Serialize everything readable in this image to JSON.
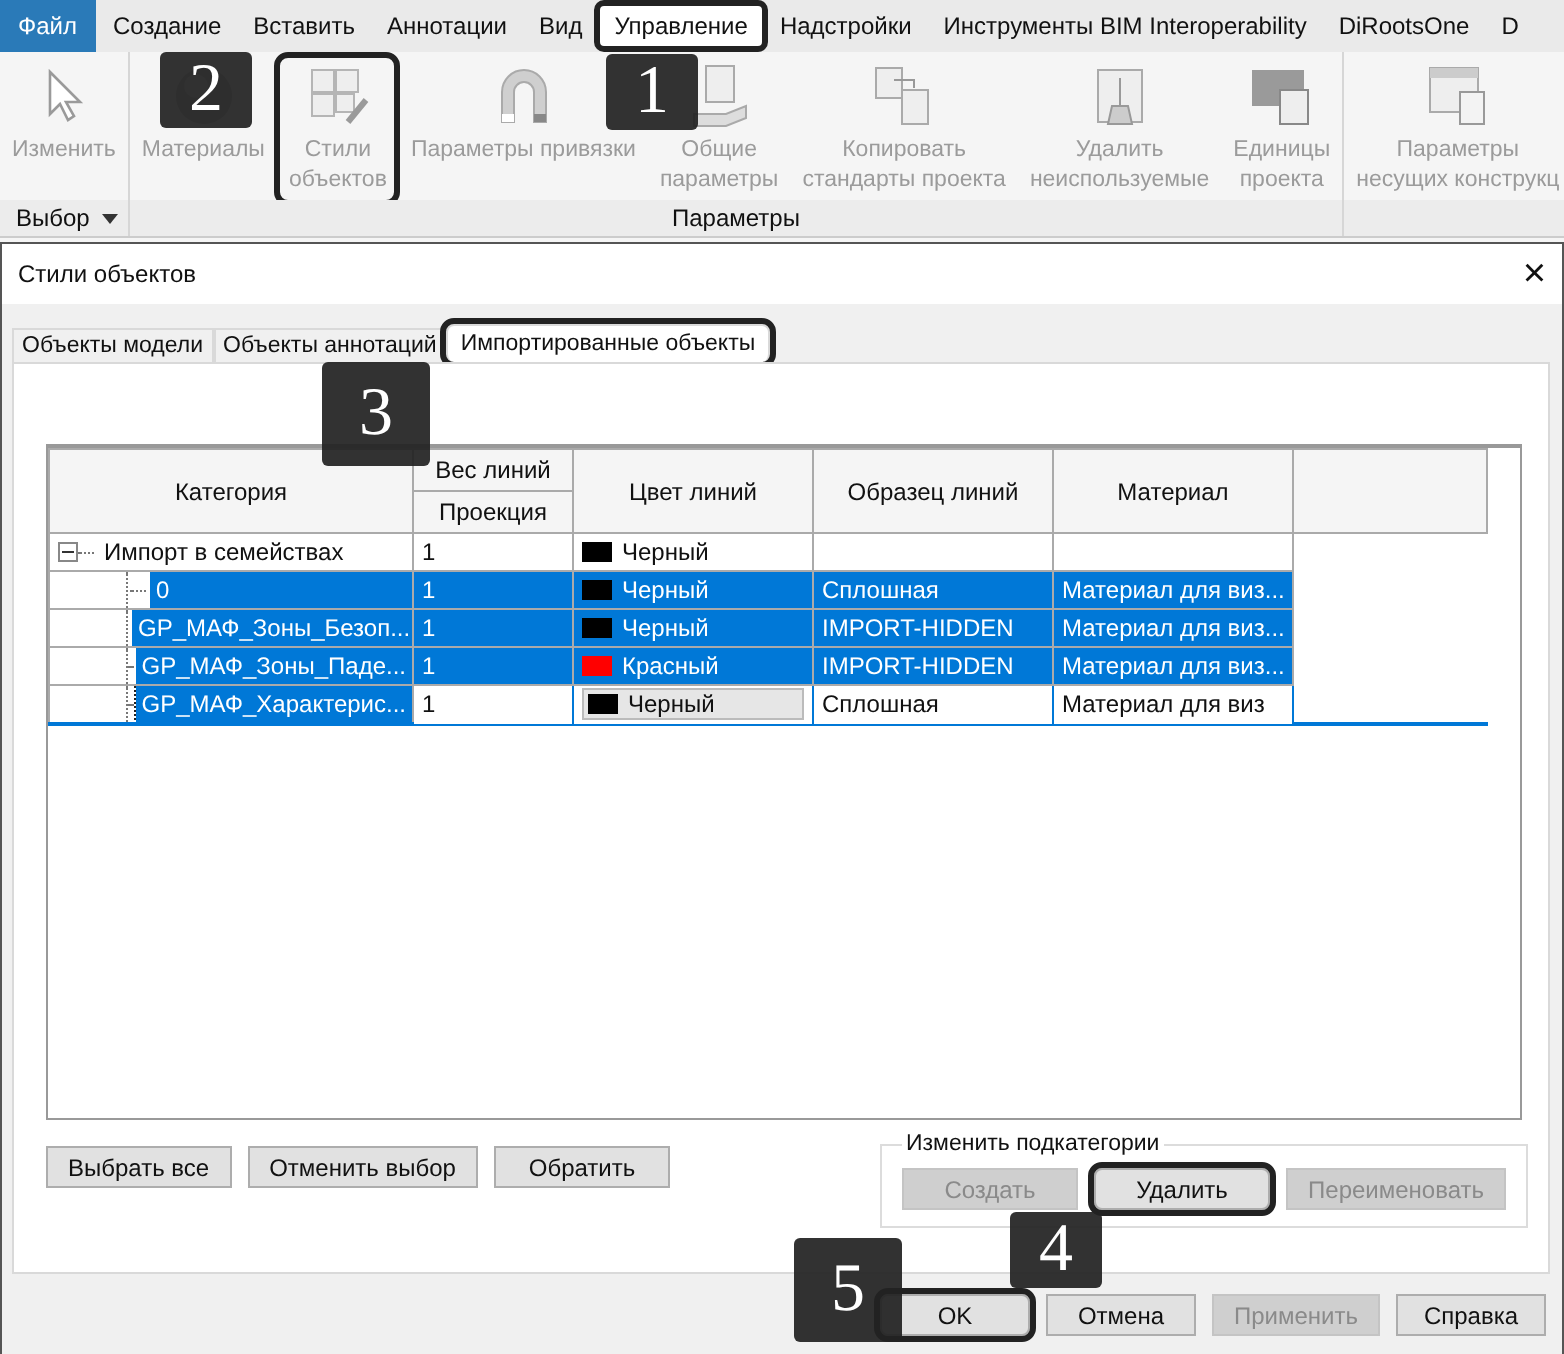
{
  "ribbon_tabs": [
    {
      "label": "Файл",
      "kind": "file",
      "selected": false,
      "highlighted": false
    },
    {
      "label": "Создание",
      "kind": "tab",
      "selected": false,
      "highlighted": false
    },
    {
      "label": "Вставить",
      "kind": "tab",
      "selected": false,
      "highlighted": false
    },
    {
      "label": "Аннотации",
      "kind": "tab",
      "selected": false,
      "highlighted": false
    },
    {
      "label": "Вид",
      "kind": "tab",
      "selected": false,
      "highlighted": false
    },
    {
      "label": "Управление",
      "kind": "tab",
      "selected": true,
      "highlighted": true
    },
    {
      "label": "Надстройки",
      "kind": "tab",
      "selected": false,
      "highlighted": false
    },
    {
      "label": "Инструменты BIM Interoperability",
      "kind": "tab",
      "selected": false,
      "highlighted": false
    },
    {
      "label": "DiRootsOne",
      "kind": "tab",
      "selected": false,
      "highlighted": false
    },
    {
      "label": "D",
      "kind": "tab",
      "selected": false,
      "highlighted": false
    }
  ],
  "ribbon_panels": [
    {
      "label": "Выбор",
      "dropdown": true,
      "tools": [
        {
          "kind": "pointer",
          "lines": [
            "Изменить"
          ],
          "highlighted": false
        }
      ]
    },
    {
      "label": "Параметры",
      "dropdown": false,
      "tools": [
        {
          "kind": "sphere",
          "lines": [
            "Материалы"
          ],
          "highlighted": false
        },
        {
          "kind": "cubes",
          "lines": [
            "Стили",
            "объектов"
          ],
          "highlighted": true
        },
        {
          "kind": "magnet",
          "lines": [
            "Параметры привязки"
          ],
          "highlighted": false
        },
        {
          "kind": "shared",
          "lines": [
            "Общие",
            "параметры"
          ],
          "highlighted": false
        },
        {
          "kind": "copy",
          "lines": [
            "Копировать",
            "стандарты проекта"
          ],
          "highlighted": false
        },
        {
          "kind": "purge",
          "lines": [
            "Удалить",
            "неиспользуемые"
          ],
          "highlighted": false
        },
        {
          "kind": "units",
          "lines": [
            "Единицы",
            "проекта"
          ],
          "highlighted": false
        }
      ]
    },
    {
      "dropdown": false,
      "tools": [
        {
          "kind": "structural",
          "lines": [
            "Параметры",
            "несущих конструкц"
          ],
          "highlighted": false
        }
      ]
    }
  ],
  "dialog": {
    "title": "Стили объектов",
    "close": "×",
    "tabs": [
      {
        "label": "Объекты модели",
        "selected": false,
        "highlighted": false
      },
      {
        "label": "Объекты аннотаций",
        "selected": false,
        "highlighted": false
      },
      {
        "label": "Импортированные объекты",
        "selected": true,
        "highlighted": true
      }
    ],
    "table": {
      "columns": [
        {
          "label": "Категория"
        },
        {
          "label": "Вес линий",
          "sublabel": "Проекция"
        },
        {
          "label": "Цвет линий"
        },
        {
          "label": "Образец линий"
        },
        {
          "label": "Материал"
        }
      ],
      "rows": [
        {
          "category": "Импорт в семействах",
          "expanded": true,
          "selected": false,
          "editing": false,
          "weight": "1",
          "color": "#000000",
          "color_name": "Черный",
          "children": [
            {
              "category": "0",
              "selected": true,
              "editing": false,
              "weight": "1",
              "color": "#000000",
              "color_name": "Черный",
              "pattern": "Сплошная",
              "material": "Материал для виз..."
            },
            {
              "category": "GP_МАФ_Зоны_Безоп...",
              "selected": true,
              "editing": false,
              "weight": "1",
              "color": "#000000",
              "color_name": "Черный",
              "pattern": "IMPORT-HIDDEN",
              "material": "Материал для виз..."
            },
            {
              "category": "GP_МАФ_Зоны_Паде...",
              "selected": true,
              "editing": false,
              "weight": "1",
              "color": "#ff0000",
              "color_name": "Красный",
              "pattern": "IMPORT-HIDDEN",
              "material": "Материал для виз..."
            },
            {
              "category": "GP_МАФ_Характерис...",
              "selected": true,
              "editing": true,
              "weight": "1",
              "color": "#000000",
              "color_name": "Черный",
              "pattern": "Сплошная",
              "material": "Материал для виз"
            }
          ]
        }
      ]
    },
    "selection_buttons": [
      "Выбрать все",
      "Отменить выбор",
      "Обратить"
    ],
    "subcategories": {
      "title": "Изменить подкатегории",
      "buttons": [
        {
          "label": "Создать",
          "disabled": true,
          "highlighted": false
        },
        {
          "label": "Удалить",
          "disabled": false,
          "highlighted": true
        },
        {
          "label": "Переименовать",
          "disabled": true,
          "highlighted": false
        }
      ]
    },
    "footer_buttons": [
      {
        "label": "OK",
        "disabled": false,
        "highlighted": true
      },
      {
        "label": "Отмена",
        "disabled": false,
        "highlighted": false
      },
      {
        "label": "Применить",
        "disabled": true,
        "highlighted": false
      },
      {
        "label": "Справка",
        "disabled": false,
        "highlighted": false
      }
    ]
  },
  "callouts": [
    "1",
    "2",
    "3",
    "4",
    "5"
  ]
}
